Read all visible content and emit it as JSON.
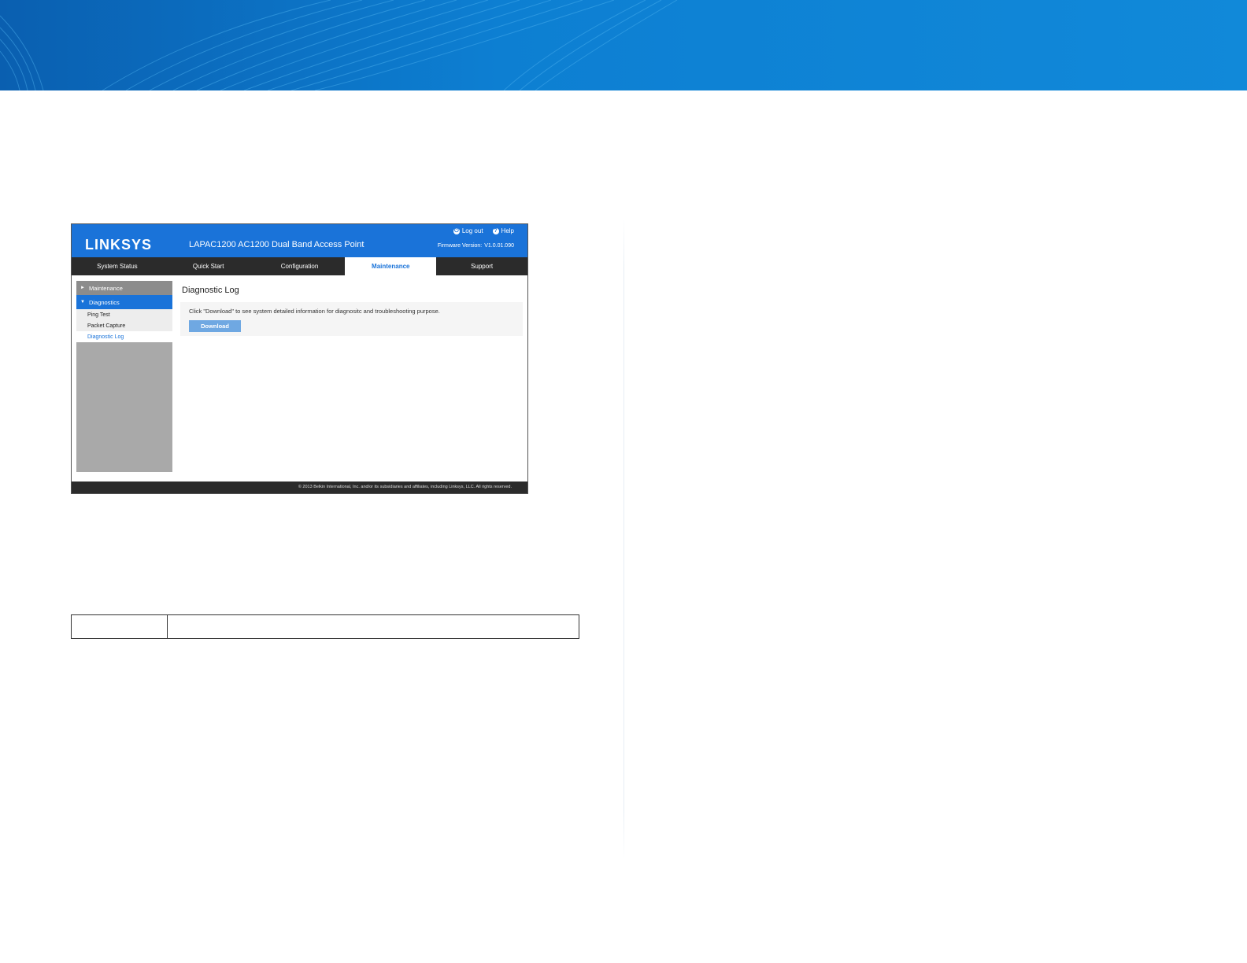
{
  "colors": {
    "accent": "#1a73d9",
    "banner": "#0d7fd2",
    "dark_bar": "#2b2b2b",
    "sidebar_gray": "#a9a9a9"
  },
  "app": {
    "logo": "LINKSYS",
    "product_title": "LAPAC1200 AC1200 Dual Band Access Point",
    "logout_label": "Log out",
    "help_label": "Help",
    "firmware_label": "Firmware Version:",
    "firmware_value": "V1.0.01.090"
  },
  "tabs": [
    {
      "label": "System Status"
    },
    {
      "label": "Quick Start"
    },
    {
      "label": "Configuration"
    },
    {
      "label": "Maintenance",
      "active": true
    },
    {
      "label": "Support"
    }
  ],
  "sidebar": {
    "maintenance_label": "Maintenance",
    "diagnostics_label": "Diagnostics",
    "items": [
      {
        "label": "Ping Test"
      },
      {
        "label": "Packet Capture"
      },
      {
        "label": "Diagnostic Log",
        "active": true
      }
    ]
  },
  "content": {
    "title": "Diagnostic Log",
    "description": "Click \"Download\" to see system detailed information for diagnositc and troubleshooting purpose.",
    "download_label": "Download"
  },
  "footer": {
    "copyright": "© 2013 Belkin International, Inc. and/or its subsidiaries and affiliates, including Linksys, LLC. All rights reserved."
  }
}
